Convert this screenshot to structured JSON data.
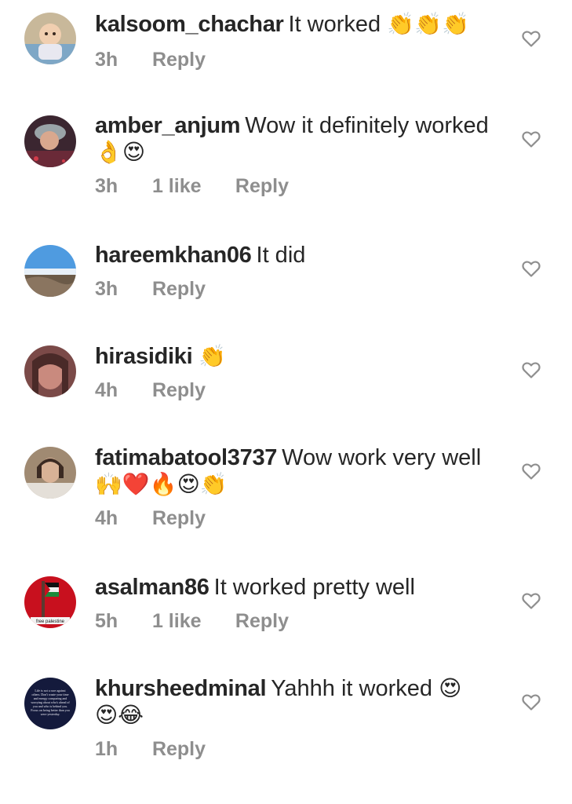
{
  "comments": [
    {
      "user": "kalsoom_chachar",
      "text": "It worked",
      "emoji": "👏👏👏",
      "emoji2": "",
      "time": "3h",
      "likes": "",
      "reply": "Reply"
    },
    {
      "user": "amber_anjum",
      "text": "Wow it definitely worked",
      "emoji": "",
      "emoji2": "👌😍",
      "time": "3h",
      "likes": "1 like",
      "reply": "Reply"
    },
    {
      "user": "hareemkhan06",
      "text": "It did",
      "emoji": "",
      "emoji2": "",
      "time": "3h",
      "likes": "",
      "reply": "Reply"
    },
    {
      "user": "hirasidiki",
      "text": "",
      "emoji": "👏",
      "emoji2": "",
      "time": "4h",
      "likes": "",
      "reply": "Reply"
    },
    {
      "user": "fatimabatool3737",
      "text": "Wow work very well",
      "emoji": "",
      "emoji2": "🙌❤️🔥😍👏",
      "time": "4h",
      "likes": "",
      "reply": "Reply"
    },
    {
      "user": "asalman86",
      "text": "It worked pretty well",
      "emoji": "",
      "emoji2": "",
      "time": "5h",
      "likes": "1 like",
      "reply": "Reply"
    },
    {
      "user": "khursheedminal",
      "text": "Yahhh it worked",
      "emoji": "😍",
      "emoji2": "😍😂",
      "time": "1h",
      "likes": "",
      "reply": "Reply"
    }
  ],
  "avatars": {
    "asalman86_caption": "free palestine",
    "khursheedminal_caption": "Life is not a race against others. Don't waste your time and energy comparing and worrying about who's ahead of you and who is behind you. Focus on being better than you were yesterday."
  },
  "icons": {
    "like": "heart-outline-icon"
  },
  "colors": {
    "text": "#262626",
    "meta": "#8e8e8e",
    "heart": "#8e8e8e"
  }
}
